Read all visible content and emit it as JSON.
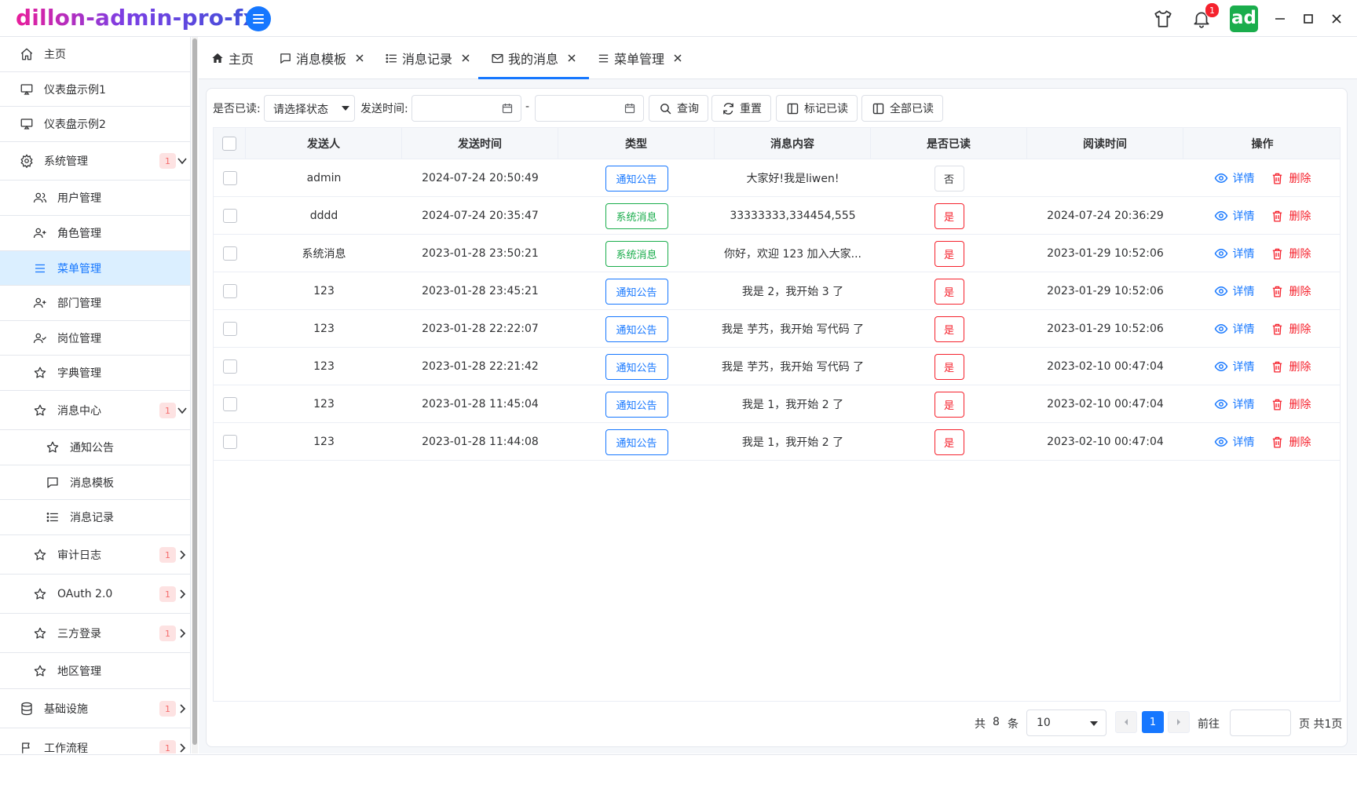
{
  "app": {
    "title": "dillon-admin-pro-fx",
    "avatar_text": "ad",
    "notification_count": "1"
  },
  "icons": {
    "menu_toggle": "menu-icon",
    "theme": "tshirt-icon",
    "bell": "bell-icon",
    "minimize": "minimize-icon",
    "maximize": "maximize-icon",
    "close": "close-icon"
  },
  "colors": {
    "primary": "#1677ff",
    "success": "#1aad4c",
    "danger": "#f5222d",
    "active_bg": "#dbefff"
  },
  "sidebar": {
    "items": [
      {
        "label": "主页",
        "icon": "home-icon"
      },
      {
        "label": "仪表盘示例1",
        "icon": "monitor-icon"
      },
      {
        "label": "仪表盘示例2",
        "icon": "monitor-icon"
      },
      {
        "label": "系统管理",
        "icon": "gear-icon",
        "badge": "1"
      },
      {
        "label": "用户管理",
        "icon": "users-icon"
      },
      {
        "label": "角色管理",
        "icon": "user-plus-icon"
      },
      {
        "label": "菜单管理",
        "icon": "list-icon",
        "active": true
      },
      {
        "label": "部门管理",
        "icon": "user-plus-icon"
      },
      {
        "label": "岗位管理",
        "icon": "user-check-icon"
      },
      {
        "label": "字典管理",
        "icon": "star-icon"
      },
      {
        "label": "消息中心",
        "icon": "star-icon",
        "badge": "1"
      },
      {
        "label": "通知公告",
        "icon": "star-icon"
      },
      {
        "label": "消息模板",
        "icon": "chat-icon"
      },
      {
        "label": "消息记录",
        "icon": "list-bullet-icon"
      },
      {
        "label": "审计日志",
        "icon": "star-icon",
        "badge": "1"
      },
      {
        "label": "OAuth 2.0",
        "icon": "star-icon",
        "badge": "1"
      },
      {
        "label": "三方登录",
        "icon": "star-icon",
        "badge": "1"
      },
      {
        "label": "地区管理",
        "icon": "star-icon"
      },
      {
        "label": "基础设施",
        "icon": "database-icon",
        "badge": "1"
      },
      {
        "label": "工作流程",
        "icon": "flag-icon",
        "badge": "1"
      }
    ]
  },
  "tabs": [
    {
      "label": "主页",
      "icon": "home-icon"
    },
    {
      "label": "消息模板",
      "icon": "chat-icon"
    },
    {
      "label": "消息记录",
      "icon": "list-bullet-icon"
    },
    {
      "label": "我的消息",
      "icon": "mail-icon",
      "active": true
    },
    {
      "label": "菜单管理",
      "icon": "list-icon"
    }
  ],
  "search": {
    "read_label": "是否已读:",
    "read_placeholder": "请选择状态",
    "time_label": "发送时间:",
    "range_separator": "-",
    "query_button": "查询",
    "reset_button": "重置",
    "mark_read_button": "标记已读",
    "all_read_button": "全部已读"
  },
  "table": {
    "columns": [
      "发送人",
      "发送时间",
      "类型",
      "消息内容",
      "是否已读",
      "阅读时间",
      "操作"
    ],
    "detail_label": "详情",
    "delete_label": "删除",
    "rows": [
      {
        "sender": "admin",
        "send_time": "2024-07-24 20:50:49",
        "type": "通知公告",
        "content": "大家好!我是liwen!",
        "read": "否",
        "read_time": ""
      },
      {
        "sender": "dddd",
        "send_time": "2024-07-24 20:35:47",
        "type": "系统消息",
        "content": "33333333,334454,555",
        "read": "是",
        "read_time": "2024-07-24 20:36:29"
      },
      {
        "sender": "系统消息",
        "send_time": "2023-01-28 23:50:21",
        "type": "系统消息",
        "content": "你好，欢迎 123 加入大家...",
        "read": "是",
        "read_time": "2023-01-29 10:52:06"
      },
      {
        "sender": "123",
        "send_time": "2023-01-28 23:45:21",
        "type": "通知公告",
        "content": "我是 2，我开始 3 了",
        "read": "是",
        "read_time": "2023-01-29 10:52:06"
      },
      {
        "sender": "123",
        "send_time": "2023-01-28 22:22:07",
        "type": "通知公告",
        "content": "我是 芋艿，我开始 写代码 了",
        "read": "是",
        "read_time": "2023-01-29 10:52:06"
      },
      {
        "sender": "123",
        "send_time": "2023-01-28 22:21:42",
        "type": "通知公告",
        "content": "我是 芋艿，我开始 写代码 了",
        "read": "是",
        "read_time": "2023-02-10 00:47:04"
      },
      {
        "sender": "123",
        "send_time": "2023-01-28 11:45:04",
        "type": "通知公告",
        "content": "我是 1，我开始 2 了",
        "read": "是",
        "read_time": "2023-02-10 00:47:04"
      },
      {
        "sender": "123",
        "send_time": "2023-01-28 11:44:08",
        "type": "通知公告",
        "content": "我是 1，我开始 2 了",
        "read": "是",
        "read_time": "2023-02-10 00:47:04"
      }
    ]
  },
  "pagination": {
    "total_prefix": "共",
    "total": "8",
    "total_suffix": "条",
    "page_size": "10",
    "current_page": "1",
    "goto_label": "前往",
    "page_suffix": "页 共1页"
  }
}
